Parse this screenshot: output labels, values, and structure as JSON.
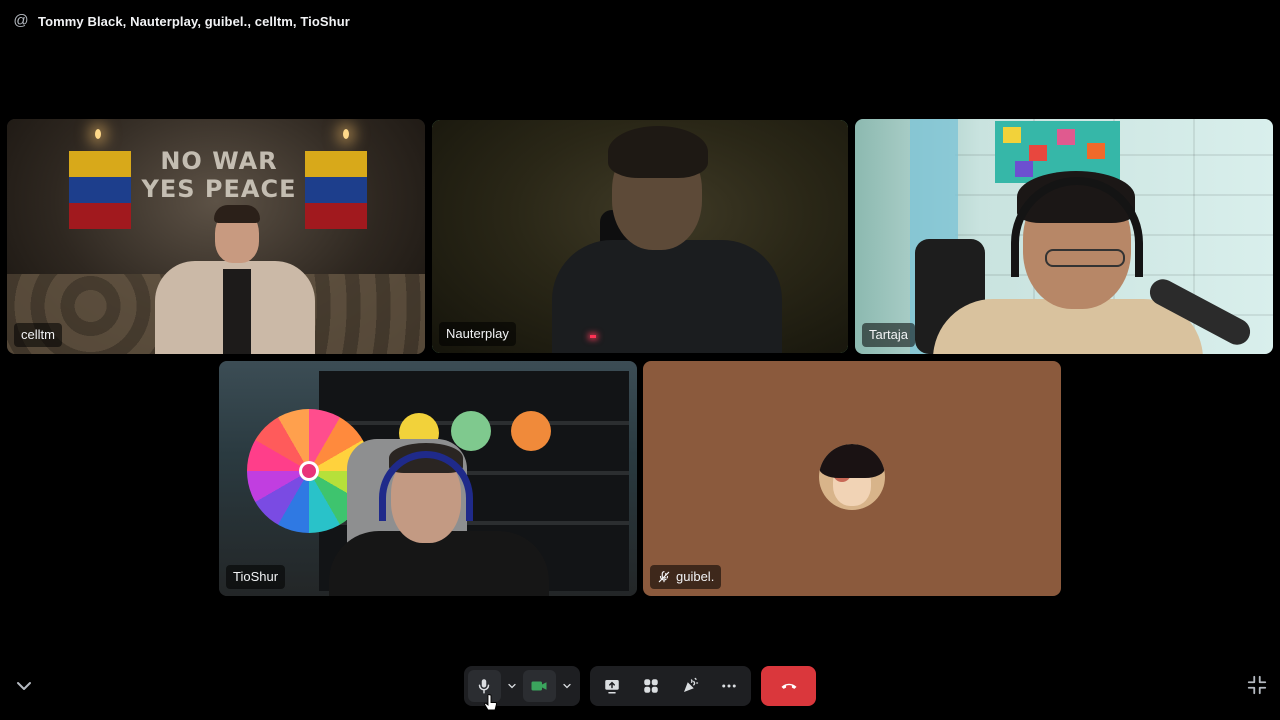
{
  "header": {
    "icon": "at-icon",
    "title": "Tommy Black, Nauterplay, guibel., celltm, TioShur"
  },
  "tiles": [
    {
      "name": "celltm",
      "speaking": false,
      "sign_text": "NO WAR\nYES PEACE"
    },
    {
      "name": "Nauterplay",
      "speaking": true
    },
    {
      "name": "Tartaja",
      "speaking": false
    },
    {
      "name": "TioShur",
      "speaking": false
    },
    {
      "name": "guibel.",
      "speaking": false,
      "muted": true,
      "camera_off": true,
      "bg_color": "#8b5a3d"
    }
  ],
  "controls": {
    "microphone": {
      "icon": "microphone-icon",
      "state": "on"
    },
    "mic_options": {
      "icon": "chevron-down-icon"
    },
    "camera": {
      "icon": "video-camera-icon",
      "state": "on",
      "color": "#3ba55d"
    },
    "camera_options": {
      "icon": "chevron-down-icon"
    },
    "share_screen": {
      "icon": "screen-share-icon"
    },
    "activities": {
      "icon": "activities-icon"
    },
    "soundboard": {
      "icon": "soundboard-icon"
    },
    "more": {
      "icon": "more-icon"
    },
    "disconnect": {
      "icon": "hang-up-icon",
      "color": "#da373c"
    }
  },
  "corner": {
    "collapse_icon": "chevron-down-icon",
    "exit_fullscreen_icon": "minimize-icon"
  }
}
